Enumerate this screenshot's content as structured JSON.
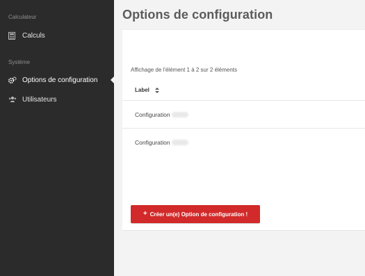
{
  "sidebar": {
    "sections": [
      {
        "title": "Calculateur",
        "items": [
          {
            "label": "Calculs",
            "icon": "calculator-icon"
          }
        ]
      },
      {
        "title": "Système",
        "items": [
          {
            "label": "Options de configuration",
            "icon": "cogs-icon",
            "active": true
          },
          {
            "label": "Utilisateurs",
            "icon": "users-icon"
          }
        ]
      }
    ]
  },
  "main": {
    "title": "Options de configuration",
    "info": "Affichage de l'élément 1 à 2 sur 2 éléments",
    "table": {
      "columns": [
        {
          "label": "Label",
          "sort_icon": "sort-icon"
        }
      ],
      "rows": [
        {
          "label": "Configuration"
        },
        {
          "label": "Configuration"
        }
      ]
    },
    "create_button": "Créer un(e) Option de configuration !"
  },
  "colors": {
    "sidebar_bg": "#2b2b2b",
    "page_bg": "#f3f3f3",
    "accent_red": "#d22a2a"
  }
}
